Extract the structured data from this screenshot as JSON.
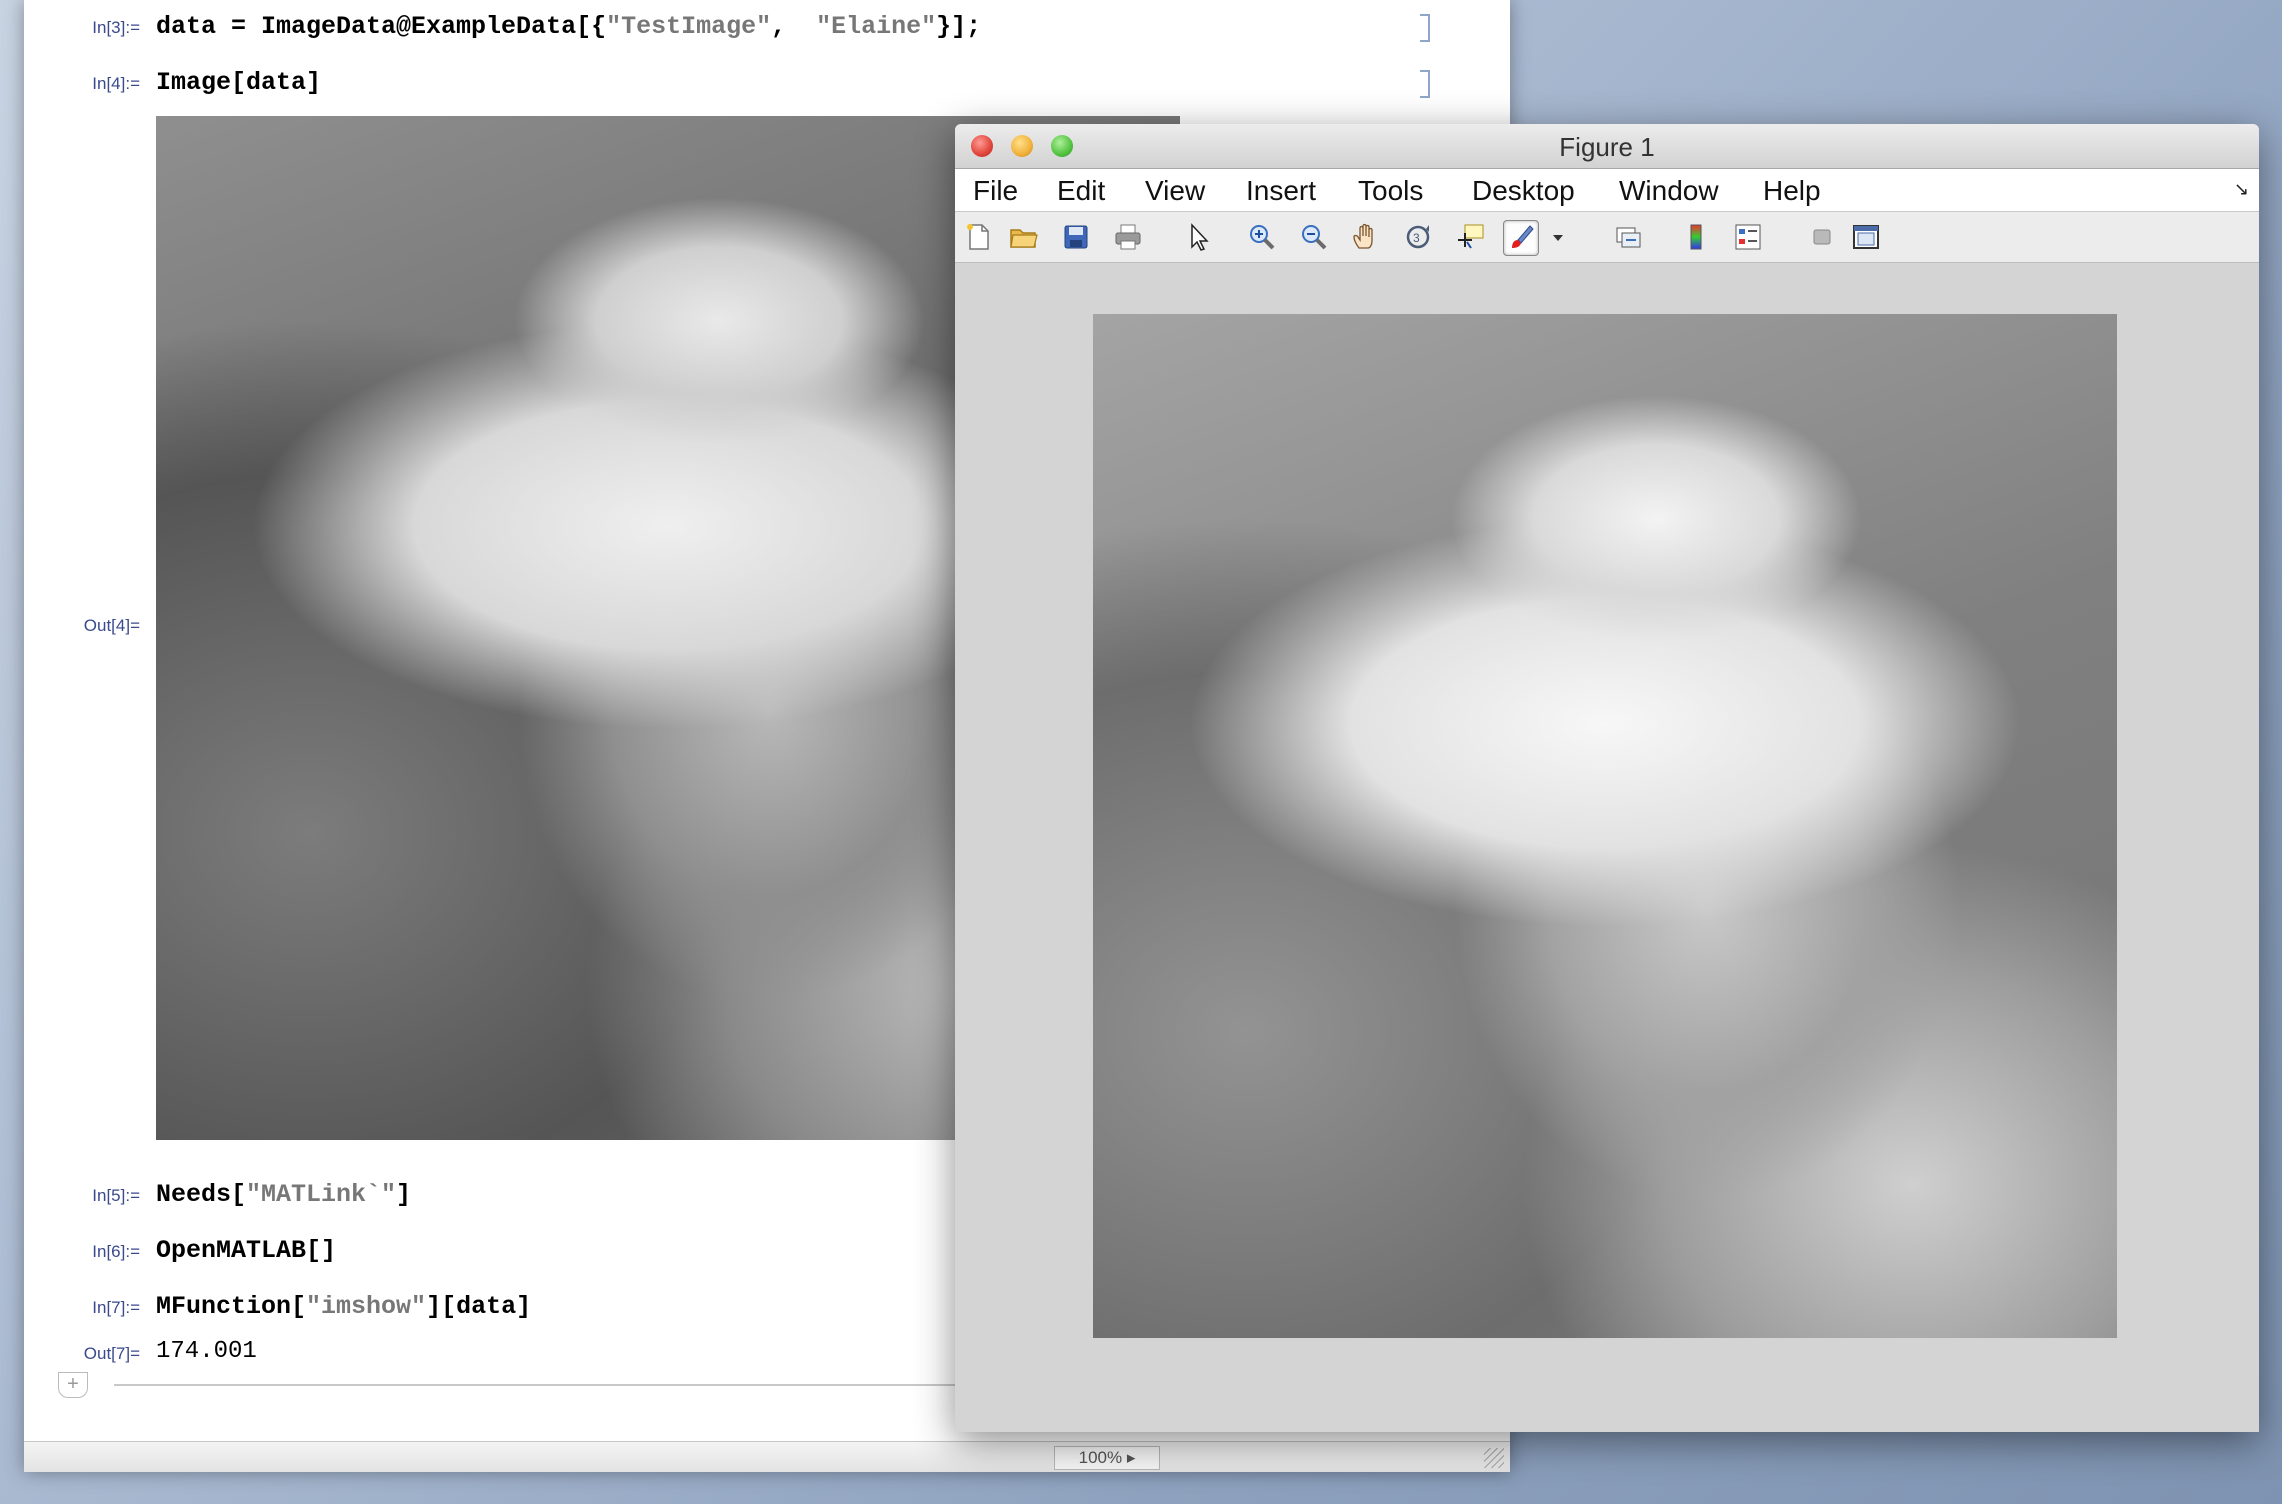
{
  "notebook": {
    "cells": [
      {
        "label": "In[3]:=",
        "code_prefix": "data = ImageData@ExampleData[{",
        "str1": "\"TestImage\"",
        "sep": ",  ",
        "str2": "\"Elaine\"",
        "code_suffix": "}];"
      },
      {
        "label": "In[4]:=",
        "code": "Image[data]"
      },
      {
        "label": "Out[4]="
      },
      {
        "label": "In[5]:=",
        "code_prefix": "Needs[",
        "str1": "\"MATLink`\"",
        "code_suffix": "]"
      },
      {
        "label": "In[6]:=",
        "code": "OpenMATLAB[]"
      },
      {
        "label": "In[7]:=",
        "code_prefix": "MFunction[",
        "str1": "\"imshow\"",
        "code_suffix": "][data]"
      },
      {
        "label": "Out[7]=",
        "output": "174.001"
      }
    ],
    "add_cell_symbol": "+",
    "zoom": "100% ▸"
  },
  "figure": {
    "title": "Figure 1",
    "menu": [
      "File",
      "Edit",
      "View",
      "Insert",
      "Tools",
      "Desktop",
      "Window",
      "Help"
    ],
    "dock_symbol": "↘",
    "toolbar": [
      "new-figure",
      "open-file",
      "save",
      "print",
      "edit-plot",
      "zoom-in",
      "zoom-out",
      "pan",
      "rotate-3d",
      "data-cursor",
      "brush",
      "brush-dropdown",
      "link-plot",
      "insert-colorbar",
      "insert-legend",
      "hide-plot-tools",
      "show-plot-tools"
    ]
  }
}
